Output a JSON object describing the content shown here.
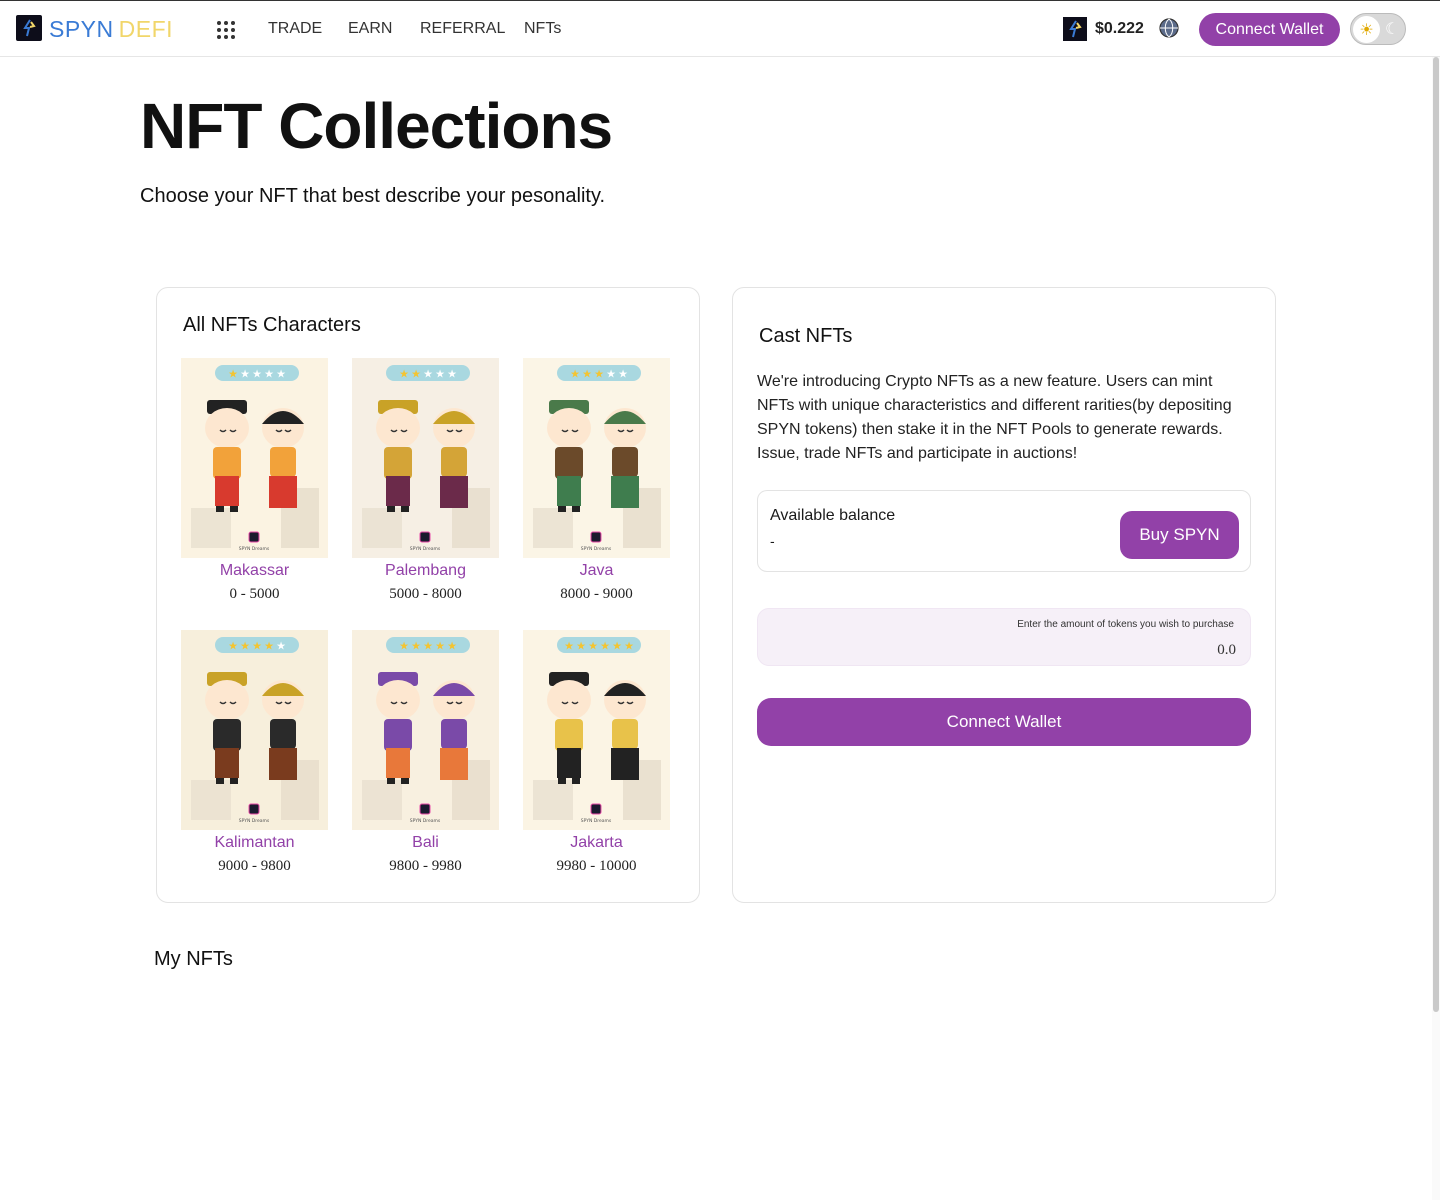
{
  "header": {
    "logo_part1": "SPYN",
    "logo_part2": "DEFI",
    "nav": [
      {
        "label": "TRADE"
      },
      {
        "label": "EARN"
      },
      {
        "label": "REFERRAL"
      },
      {
        "label": "NFTs"
      }
    ],
    "price": "$0.222",
    "connect_wallet_label": "Connect Wallet",
    "theme_sun_icon": "sun-icon",
    "theme_moon_icon": "moon-icon"
  },
  "page": {
    "title": "NFT Collections",
    "subtitle": "Choose your NFT that best describe your pesonality."
  },
  "collection": {
    "title": "All NFTs Characters",
    "items": [
      {
        "name": "Makassar",
        "range": "0 - 5000",
        "stars": 5,
        "filled_stars": 1
      },
      {
        "name": "Palembang",
        "range": "5000 - 8000",
        "stars": 5,
        "filled_stars": 2
      },
      {
        "name": "Java",
        "range": "8000 - 9000",
        "stars": 5,
        "filled_stars": 3
      },
      {
        "name": "Kalimantan",
        "range": "9000 - 9800",
        "stars": 5,
        "filled_stars": 4
      },
      {
        "name": "Bali",
        "range": "9800 - 9980",
        "stars": 5,
        "filled_stars": 5
      },
      {
        "name": "Jakarta",
        "range": "9980 - 10000",
        "stars": 6,
        "filled_stars": 6
      }
    ],
    "card_watermark": "SPYN Dreams"
  },
  "cast": {
    "title": "Cast NFTs",
    "description": "We're introducing Crypto NFTs as a new feature. Users can mint NFTs with unique characteristics and different rarities(by depositing SPYN tokens) then stake it in the NFT Pools to generate rewards. Issue, trade NFTs and participate in auctions!",
    "balance_label": "Available balance",
    "balance_value": "-",
    "buy_label": "Buy SPYN",
    "amount_hint": "Enter the amount of tokens you wish to purchase",
    "amount_value": "0.0",
    "connect_label": "Connect Wallet"
  },
  "my_nfts": {
    "title": "My NFTs"
  },
  "colors": {
    "accent": "#9241a8",
    "logo_blue": "#3a7bd5",
    "logo_yellow": "#f1d66a"
  }
}
